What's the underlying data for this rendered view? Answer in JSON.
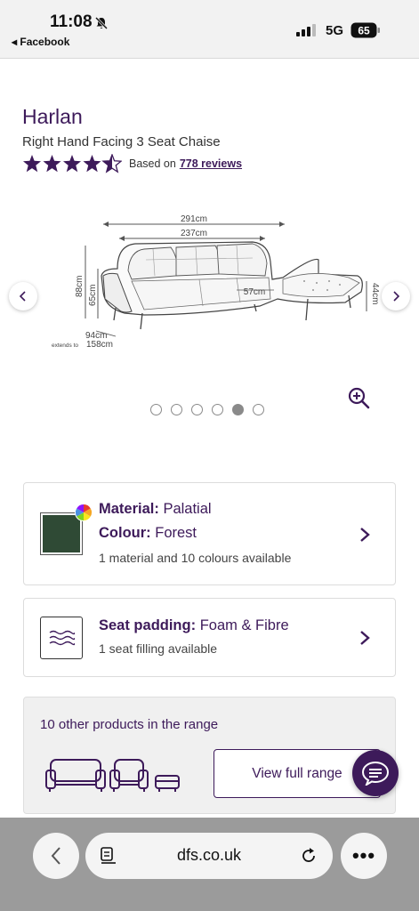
{
  "status_bar": {
    "time": "11:08",
    "back_app": "◂ Facebook",
    "network": "5G",
    "battery": "65"
  },
  "product": {
    "title": "Harlan",
    "subtitle": "Right Hand Facing 3 Seat Chaise",
    "rating": {
      "stars": 4.5,
      "max": 5,
      "based_on": "Based on",
      "reviews_link": "778 reviews"
    }
  },
  "gallery": {
    "image_labels": {
      "total_width": "291cm",
      "inner_width": "237cm",
      "chaise_width": "57cm",
      "height_back": "88cm",
      "height_seat": "65cm",
      "chaise_height": "44cm",
      "depth": "94cm",
      "extends_prefix": "extends to",
      "extends_value": "158cm"
    },
    "dots_total": 6,
    "active_dot": 5
  },
  "material_card": {
    "material_label": "Material:",
    "material_value": "Palatial",
    "colour_label": "Colour:",
    "colour_value": "Forest",
    "availability": "1 material and 10 colours available",
    "swatch_color": "#2f4a35"
  },
  "seat_card": {
    "label": "Seat padding:",
    "value": "Foam & Fibre",
    "availability": "1 seat filling available"
  },
  "range_card": {
    "title": "10 other products in the range",
    "button": "View full range"
  },
  "browser": {
    "url": "dfs.co.uk",
    "more": "•••"
  },
  "colors": {
    "brand_purple": "#3d1a5a",
    "browser_bar": "#9b9b9b"
  }
}
